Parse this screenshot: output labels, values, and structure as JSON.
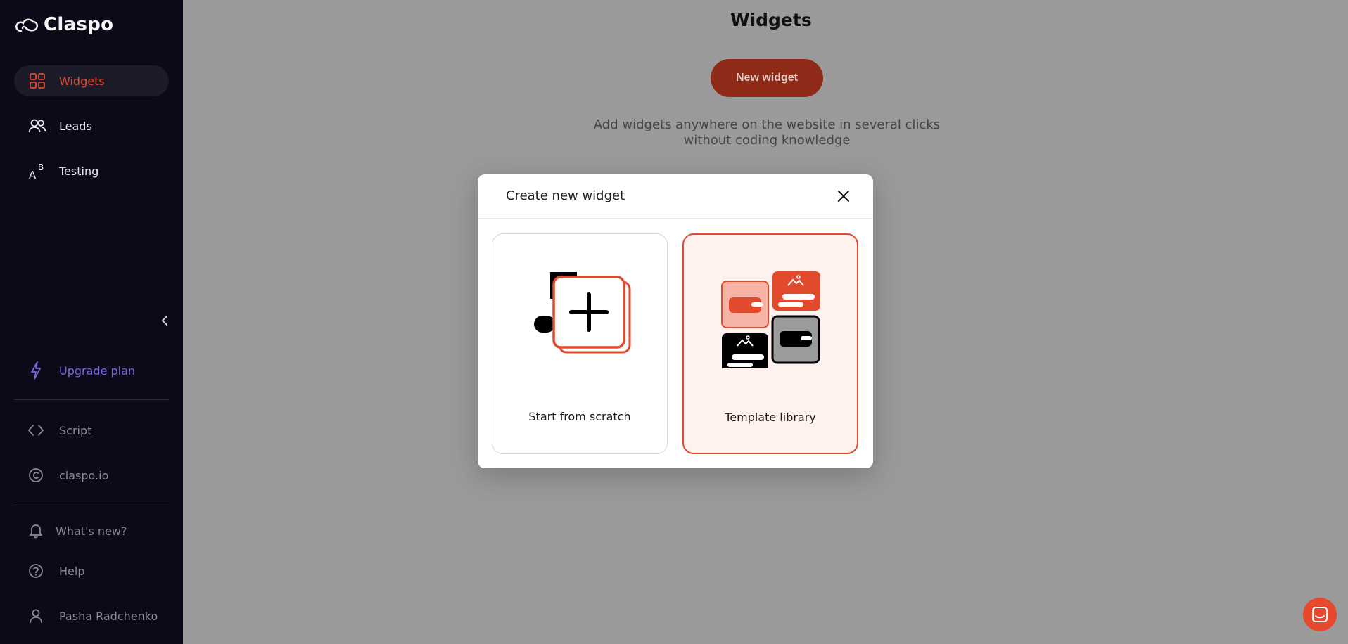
{
  "app": {
    "name": "Claspo"
  },
  "sidebar": {
    "nav": [
      {
        "label": "Widgets",
        "icon": "grid-icon",
        "active": true
      },
      {
        "label": "Leads",
        "icon": "users-icon",
        "active": false
      },
      {
        "label": "Testing",
        "icon": "ab-test-icon",
        "active": false
      }
    ],
    "links": {
      "upgrade": "Upgrade plan",
      "script": "Script",
      "site": "claspo.io",
      "whats_new": "What's new?",
      "help": "Help",
      "user": "Pasha Radchenko"
    }
  },
  "main": {
    "title": "Widgets",
    "new_widget_label": "New widget",
    "description_line1": "Add widgets anywhere on the website in several clicks",
    "description_line2": "without coding knowledge"
  },
  "modal": {
    "title": "Create new widget",
    "options": [
      {
        "label": "Start from scratch",
        "selected": false
      },
      {
        "label": "Template library",
        "selected": true
      }
    ]
  },
  "colors": {
    "accent": "#e24a2e",
    "sidebar_bg": "#0a0a18",
    "upgrade": "#7a66e0",
    "overlay_bg": "#9a9a9a"
  }
}
